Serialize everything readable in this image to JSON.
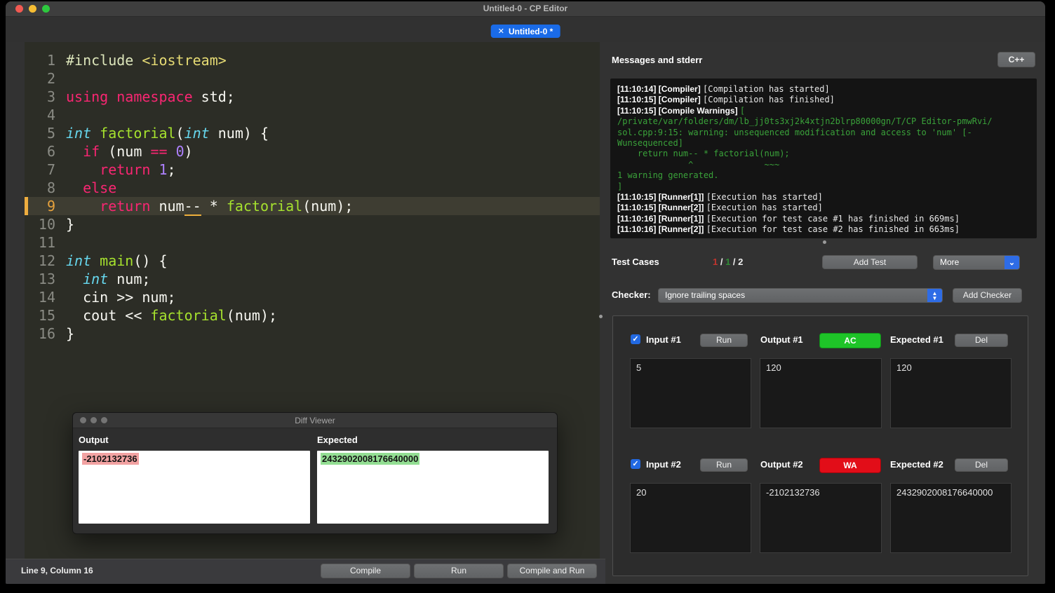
{
  "window": {
    "title": "Untitled-0 - CP Editor"
  },
  "tab": {
    "close_glyph": "✕",
    "label": "Untitled-0 *"
  },
  "editor": {
    "current_line": 9,
    "lines": [
      {
        "n": 1,
        "segs": [
          [
            "pp",
            "#include "
          ],
          [
            "str",
            "<iostream>"
          ]
        ]
      },
      {
        "n": 2,
        "segs": []
      },
      {
        "n": 3,
        "segs": [
          [
            "kw",
            "using namespace"
          ],
          [
            "pl",
            " std;"
          ]
        ]
      },
      {
        "n": 4,
        "segs": []
      },
      {
        "n": 5,
        "segs": [
          [
            "type",
            "int"
          ],
          [
            "pl",
            " "
          ],
          [
            "fn",
            "factorial"
          ],
          [
            "pl",
            "("
          ],
          [
            "type",
            "int"
          ],
          [
            "pl",
            " num) {"
          ]
        ]
      },
      {
        "n": 6,
        "segs": [
          [
            "pl",
            "  "
          ],
          [
            "kw",
            "if"
          ],
          [
            "pl",
            " (num "
          ],
          [
            "kw",
            "=="
          ],
          [
            "pl",
            " "
          ],
          [
            "num",
            "0"
          ],
          [
            "pl",
            ")"
          ]
        ]
      },
      {
        "n": 7,
        "segs": [
          [
            "pl",
            "    "
          ],
          [
            "kw",
            "return"
          ],
          [
            "pl",
            " "
          ],
          [
            "num",
            "1"
          ],
          [
            "pl",
            ";"
          ]
        ]
      },
      {
        "n": 8,
        "segs": [
          [
            "pl",
            "  "
          ],
          [
            "kw",
            "else"
          ]
        ]
      },
      {
        "n": 9,
        "segs": [
          [
            "pl",
            "    "
          ],
          [
            "kw",
            "return"
          ],
          [
            "pl",
            " num"
          ],
          [
            "ul",
            "--"
          ],
          [
            "pl",
            " * "
          ],
          [
            "fn",
            "factorial"
          ],
          [
            "pl",
            "(num);"
          ]
        ]
      },
      {
        "n": 10,
        "segs": [
          [
            "pl",
            "}"
          ]
        ]
      },
      {
        "n": 11,
        "segs": []
      },
      {
        "n": 12,
        "segs": [
          [
            "type",
            "int"
          ],
          [
            "pl",
            " "
          ],
          [
            "fn",
            "main"
          ],
          [
            "pl",
            "() {"
          ]
        ]
      },
      {
        "n": 13,
        "segs": [
          [
            "pl",
            "  "
          ],
          [
            "type",
            "int"
          ],
          [
            "pl",
            " num;"
          ]
        ]
      },
      {
        "n": 14,
        "segs": [
          [
            "pl",
            "  cin >> num;"
          ]
        ]
      },
      {
        "n": 15,
        "segs": [
          [
            "pl",
            "  cout << "
          ],
          [
            "fn",
            "factorial"
          ],
          [
            "pl",
            "(num);"
          ]
        ]
      },
      {
        "n": 16,
        "segs": [
          [
            "pl",
            "}"
          ]
        ]
      }
    ]
  },
  "console": {
    "title": "Messages and stderr",
    "lang_button": "C++",
    "lines": [
      {
        "b": "[11:10:14] [Compiler] ",
        "t": "[Compilation has started]",
        "g": false
      },
      {
        "b": "[11:10:15] [Compiler] ",
        "t": "[Compilation has finished]",
        "g": false
      },
      {
        "b": "[11:10:15] [Compile Warnings] ",
        "t": "[",
        "g": true
      },
      {
        "b": "",
        "t": "/private/var/folders/dm/lb_jj0ts3xj2k4xtjn2blrp80000gn/T/CP Editor-pmwRvi/",
        "g": true
      },
      {
        "b": "",
        "t": "sol.cpp:9:15: warning: unsequenced modification and access to 'num' [-",
        "g": true
      },
      {
        "b": "",
        "t": "Wunsequenced]",
        "g": true
      },
      {
        "b": "",
        "t": "    return num-- * factorial(num);",
        "g": true
      },
      {
        "b": "",
        "t": "              ^              ~~~",
        "g": true
      },
      {
        "b": "",
        "t": "1 warning generated.",
        "g": true
      },
      {
        "b": "",
        "t": "]",
        "g": true
      },
      {
        "b": "[11:10:15] [Runner[1]] ",
        "t": "[Execution has started]",
        "g": false
      },
      {
        "b": "[11:10:15] [Runner[2]] ",
        "t": "[Execution has started]",
        "g": false
      },
      {
        "b": "[11:10:16] [Runner[1]] ",
        "t": "[Execution for test case #1 has finished in 669ms]",
        "g": false
      },
      {
        "b": "[11:10:16] [Runner[2]] ",
        "t": "[Execution for test case #2 has finished in 663ms]",
        "g": false
      }
    ]
  },
  "testcases": {
    "title": "Test Cases",
    "counts": {
      "failed": "1",
      "sep1": " / ",
      "passed": "1",
      "sep2": " / ",
      "total": "2"
    },
    "add_test_label": "Add Test",
    "more_label": "More",
    "checker_label": "Checker:",
    "checker_value": "Ignore trailing spaces",
    "add_checker_label": "Add Checker",
    "run_label": "Run",
    "del_label": "Del",
    "check_glyph": "✓",
    "cases": [
      {
        "input_label": "Input #1",
        "output_label": "Output #1",
        "expected_label": "Expected #1",
        "verdict": "AC",
        "checked": true,
        "input": "5",
        "output": "120",
        "expected": "120"
      },
      {
        "input_label": "Input #2",
        "output_label": "Output #2",
        "expected_label": "Expected #2",
        "verdict": "WA",
        "checked": true,
        "input": "20",
        "output": "-2102132736",
        "expected": "2432902008176640000"
      }
    ]
  },
  "diff": {
    "title": "Diff Viewer",
    "output_label": "Output",
    "expected_label": "Expected",
    "output_value": "-2102132736",
    "expected_value": "2432902008176640000"
  },
  "statusbar": {
    "position": "Line 9, Column 16",
    "compile_label": "Compile",
    "run_label": "Run",
    "compile_and_run_label": "Compile and Run"
  },
  "colors": {
    "verdict_ac": "#1ec428",
    "verdict_wa": "#e20d18",
    "tab_accent": "#1a6be8",
    "dropdown_accent": "#2e6ce6",
    "warning_green": "#3aa23a",
    "current_line_marker": "#eead3f",
    "diff_removed_bg": "#f2a2a2",
    "diff_added_bg": "#93de93"
  }
}
